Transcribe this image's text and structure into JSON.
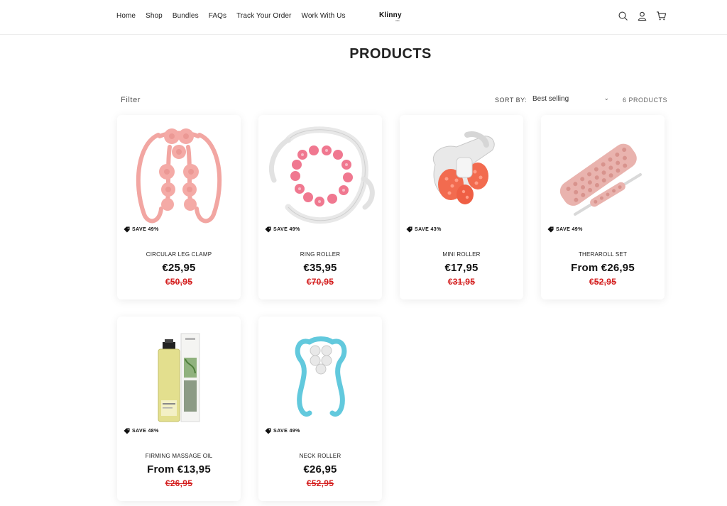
{
  "nav": {
    "links": [
      "Home",
      "Shop",
      "Bundles",
      "FAQs",
      "Track Your Order",
      "Work With Us"
    ]
  },
  "logo": {
    "brand": "Klinny",
    "sub": "care"
  },
  "header_icons": [
    "search-icon",
    "account-icon",
    "cart-icon"
  ],
  "page": {
    "title": "PRODUCTS"
  },
  "toolbar": {
    "filter_label": "Filter",
    "sort_label": "SORT BY:",
    "sort_value": "Best selling",
    "count": "6 PRODUCTS"
  },
  "products": [
    {
      "title": "CIRCULAR LEG CLAMP",
      "price": "€25,95",
      "compare": "€50,95",
      "badge": "SAVE 49%"
    },
    {
      "title": "RING ROLLER",
      "price": "€35,95",
      "compare": "€70,95",
      "badge": "SAVE 49%"
    },
    {
      "title": "MINI ROLLER",
      "price": "€17,95",
      "compare": "€31,95",
      "badge": "SAVE 43%"
    },
    {
      "title": "THERAROLL SET",
      "price": "From €26,95",
      "compare": "€52,95",
      "badge": "SAVE 49%"
    },
    {
      "title": "FIRMING MASSAGE OIL",
      "price": "From €13,95",
      "compare": "€26,95",
      "badge": "SAVE 48%"
    },
    {
      "title": "NECK ROLLER",
      "price": "€26,95",
      "compare": "€52,95",
      "badge": "SAVE 49%"
    }
  ],
  "colors": {
    "accent": "#121212",
    "sale": "#d42020",
    "pink": "#f4a9a6",
    "cyan": "#5ec8dc"
  }
}
